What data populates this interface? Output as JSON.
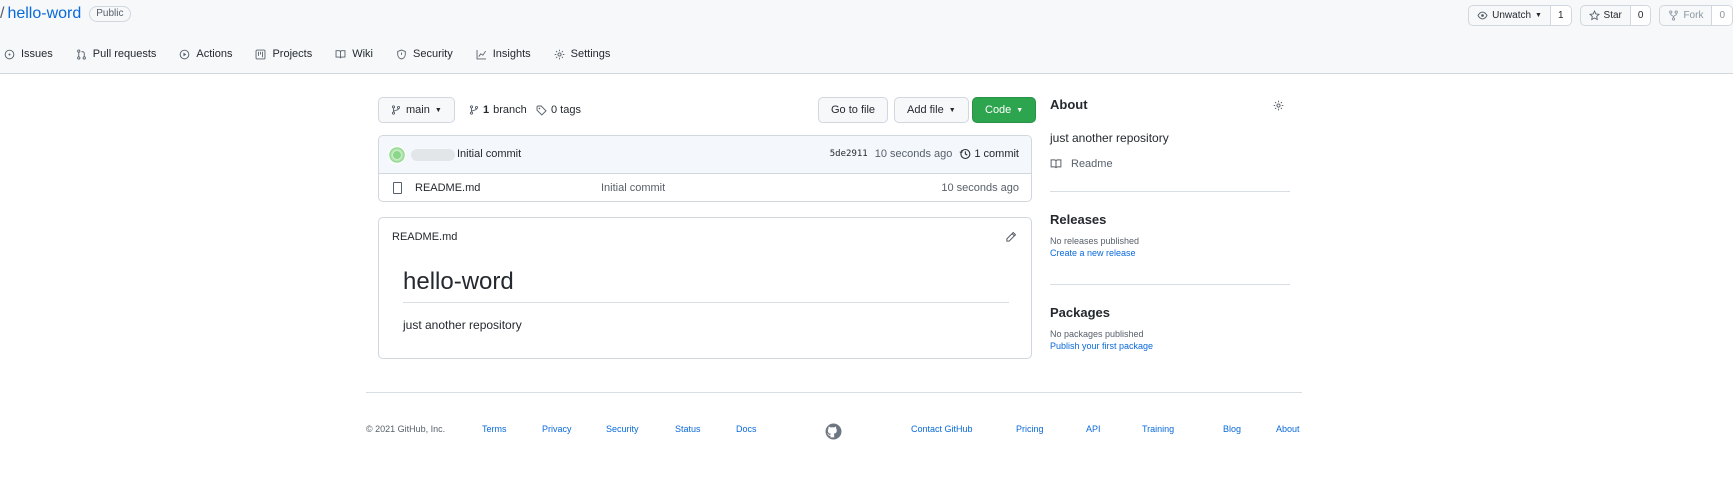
{
  "header": {
    "slash": "/",
    "repo_name": "hello-word",
    "visibility": "Public",
    "unwatch_label": "Unwatch",
    "watch_count": "1",
    "star_label": "Star",
    "star_count": "0",
    "fork_label": "Fork",
    "fork_count": "0"
  },
  "tabs": [
    {
      "label": "Issues",
      "icon": "issue-icon"
    },
    {
      "label": "Pull requests",
      "icon": "pull-request-icon"
    },
    {
      "label": "Actions",
      "icon": "play-icon"
    },
    {
      "label": "Projects",
      "icon": "project-board-icon"
    },
    {
      "label": "Wiki",
      "icon": "book-icon"
    },
    {
      "label": "Security",
      "icon": "shield-icon"
    },
    {
      "label": "Insights",
      "icon": "graph-icon"
    },
    {
      "label": "Settings",
      "icon": "gear-icon"
    }
  ],
  "toolbar": {
    "branch": "main",
    "branch_count": "1",
    "branch_word": "branch",
    "tags_label": "0 tags",
    "go_to_file": "Go to file",
    "add_file": "Add file",
    "code": "Code"
  },
  "commit": {
    "message": "Initial commit",
    "sha": "5de2911",
    "age": "10 seconds ago",
    "count_label": "1 commit"
  },
  "files": [
    {
      "name": "README.md",
      "message": "Initial commit",
      "age": "10 seconds ago"
    }
  ],
  "readme": {
    "file_name": "README.md",
    "heading": "hello-word",
    "body": "just another repository"
  },
  "about": {
    "title": "About",
    "description": "just another repository",
    "readme_label": "Readme"
  },
  "releases": {
    "title": "Releases",
    "empty": "No releases published",
    "link": "Create a new release"
  },
  "packages": {
    "title": "Packages",
    "empty": "No packages published",
    "link": "Publish your first package"
  },
  "footer": {
    "copyright": "© 2021 GitHub, Inc.",
    "links_left": [
      "Terms",
      "Privacy",
      "Security",
      "Status",
      "Docs"
    ],
    "links_right": [
      "Contact GitHub",
      "Pricing",
      "API",
      "Training",
      "Blog",
      "About"
    ]
  },
  "colors": {
    "accent": "#0969da",
    "code_button": "#2da44e",
    "header_bg": "#f6f8fa"
  }
}
